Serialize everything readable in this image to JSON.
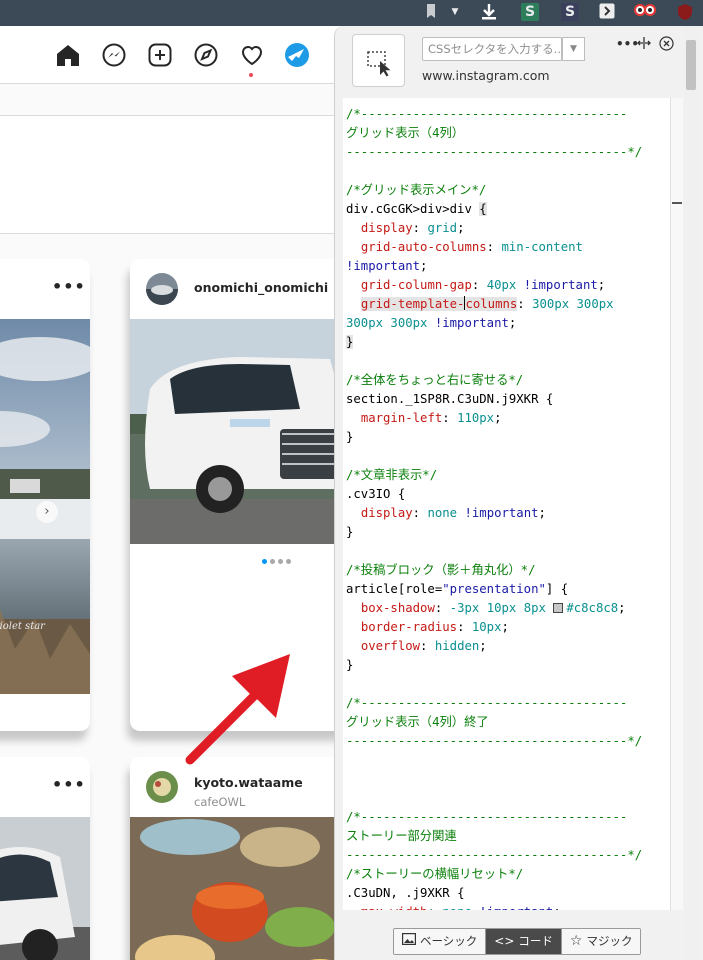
{
  "browser": {
    "extensions": [
      "bookmark-icon",
      "download-icon",
      "s-extension",
      "s-profile-extension",
      "forward-icon",
      "goggles-icon",
      "ublock-icon"
    ],
    "ext_s_label": "S",
    "ext_s2_label": "S"
  },
  "instagram": {
    "nav_icons": [
      "home-icon",
      "messenger-icon",
      "new-post-icon",
      "explore-icon",
      "activity-heart-icon",
      "profile-avatar"
    ],
    "posts": [
      {
        "username": "",
        "more": "•••"
      },
      {
        "username": "onomichi_onomichi",
        "more": "•••",
        "carousel_count": 4,
        "carousel_active": 0
      },
      {
        "username": "",
        "more": "•••"
      },
      {
        "username": "kyoto.wataame",
        "sublabel": "cafeOWL",
        "more": "•••"
      }
    ],
    "watermark": "er violet star"
  },
  "panel": {
    "selector_placeholder": "CSSセレクタを入力する...",
    "domain": "www.instagram.com",
    "menu_icon": "•••",
    "modes": [
      {
        "label": "ベーシック",
        "icon": "image-icon",
        "active": false
      },
      {
        "label": "コード",
        "icon": "code-icon",
        "active": true
      },
      {
        "label": "マジック",
        "icon": "star-icon",
        "active": false
      }
    ],
    "code_icon_glyph": "<>",
    "star_glyph": "☆"
  },
  "code": {
    "c1a": "/*------------------------------------",
    "c1b": "グリッド表示（4列）",
    "c1c": "--------------------------------------*/",
    "c2": "/*グリッド表示メイン*/",
    "sel1": "div.cGcGK>div>div ",
    "p_display": "display",
    "v_grid": "grid",
    "p_gac": "grid-auto-columns",
    "v_minc": "min-content",
    "imp": "!important",
    "p_gcg": "grid-column-gap",
    "v_40": "40px",
    "p_gtc_a": "grid-template-",
    "p_gtc_b": "columns",
    "v_300a": "300px 300px",
    "v_300b": "300px 300px",
    "c3": "/*全体をちょっと右に寄せる*/",
    "sel2": "section._1SP8R.C3uDN.j9XKR ",
    "p_ml": "margin-left",
    "v_110": "110px",
    "c4": "/*文章非表示*/",
    "sel3": ".cv3IO ",
    "v_none": "none",
    "c5": "/*投稿ブロック（影＋角丸化）*/",
    "sel4a": "article[role=",
    "sel4b": "\"presentation\"",
    "sel4c": "] ",
    "p_bs": "box-shadow",
    "v_bs": "-3px 10px 8px ",
    "v_hex": "#c8c8c8",
    "p_br": "border-radius",
    "v_10": "10px",
    "p_ov": "overflow",
    "v_hidden": "hidden",
    "c6a": "/*------------------------------------",
    "c6b": "グリッド表示（4列）終了",
    "c6c": "--------------------------------------*/",
    "c7a": "/*------------------------------------",
    "c7b": "ストーリー部分関連",
    "c7c": "--------------------------------------*/",
    "c8": "/*ストーリーの横幅リセット*/",
    "sel5": ".C3uDN, .j9XKR ",
    "p_mw": "max-width",
    "colors": {
      "swatch": "#c8c8c8",
      "accent": "#0095f6"
    }
  }
}
